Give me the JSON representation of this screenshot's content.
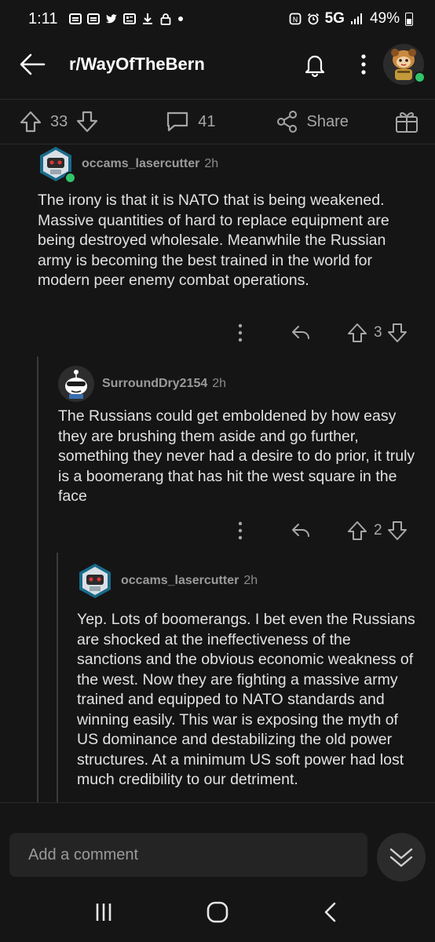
{
  "status_bar": {
    "time": "1:11",
    "network": "5G",
    "battery": "49%",
    "icons": [
      "gallery-icon",
      "gallery-icon",
      "twitter-icon",
      "news-icon",
      "download-icon",
      "lock-icon",
      "dot-icon",
      "nfc-icon",
      "alarm-icon",
      "signal-icon"
    ]
  },
  "app_bar": {
    "subreddit": "r/WayOfTheBern",
    "icons": [
      "back-arrow-icon",
      "bell-icon",
      "more-vertical-icon",
      "user-avatar"
    ]
  },
  "post_actions": {
    "votes": "33",
    "comments": "41",
    "share_label": "Share"
  },
  "comments": [
    {
      "username": "occams_lasercutter",
      "time": "2h",
      "body": "The irony is that it is NATO that is being weakened. Massive quantities of hard to replace equipment are being destroyed wholesale. Meanwhile the Russian army is becoming the best trained in the world for modern peer enemy combat operations.",
      "score": "3"
    },
    {
      "username": "SurroundDry2154",
      "time": "2h",
      "body": "The Russians could get emboldened by how easy they are brushing them aside and go further, something they never had a desire to do prior, it truly is a boomerang that has hit the west square in the face",
      "score": "2"
    },
    {
      "username": "occams_lasercutter",
      "time": "2h",
      "body": "Yep. Lots of boomerangs. I bet even the Russians are shocked at the ineffectiveness of the sanctions and the obvious economic weakness of the west. Now they are fighting a massive army trained and equipped to NATO standards and winning easily. This war is exposing the myth of US dominance and destabilizing the old power structures. At a minimum US soft power had lost much credibility to our detriment."
    }
  ],
  "composer": {
    "placeholder": "Add a comment"
  },
  "nav": {
    "icons": [
      "recent-apps-icon",
      "home-icon",
      "back-icon"
    ]
  },
  "colors": {
    "background": "#151515",
    "text": "#e2e2e2",
    "muted": "#9a9a9a",
    "online": "#31c46b"
  }
}
